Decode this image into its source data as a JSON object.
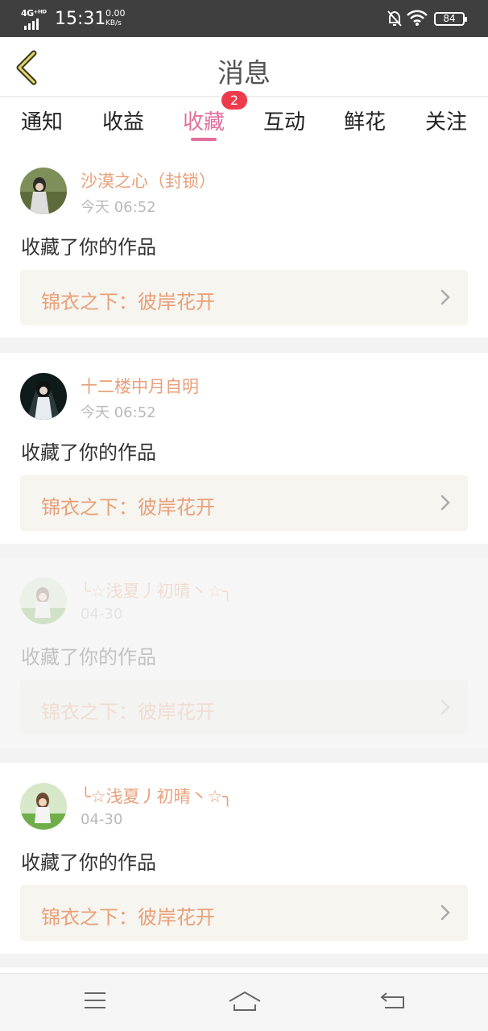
{
  "status_bar": {
    "network": "4G⁺ᴴᴰ",
    "time": "15:31",
    "speed_value": "0.00",
    "speed_unit": "KB/s",
    "battery": "84"
  },
  "header": {
    "title": "消息",
    "back_icon": "chevron-left-icon"
  },
  "tabs": [
    {
      "label": "通知"
    },
    {
      "label": "收益"
    },
    {
      "label": "收藏",
      "active": true,
      "badge": "2"
    },
    {
      "label": "互动"
    },
    {
      "label": "鲜花"
    },
    {
      "label": "关注"
    }
  ],
  "messages": [
    {
      "user": "沙漠之心（封锁）",
      "time": "今天 06:52",
      "action": "收藏了你的作品",
      "work": "锦衣之下：彼岸花开"
    },
    {
      "user": "十二楼中月自明",
      "time": "今天 06:52",
      "action": "收藏了你的作品",
      "work": "锦衣之下：彼岸花开"
    },
    {
      "user": "╰☆浅夏丿初晴丶☆╮",
      "time": "04-30",
      "action": "收藏了你的作品",
      "work": "锦衣之下：彼岸花开"
    },
    {
      "user": "╰☆浅夏丿初晴丶☆╮",
      "time": "04-30",
      "action": "收藏了你的作品",
      "work": "锦衣之下：彼岸花开"
    }
  ],
  "nav_bar": {
    "menu_icon": "menu-icon",
    "home_icon": "home-icon",
    "back_icon": "back-icon"
  },
  "colors": {
    "accent": "#e0709c",
    "username": "#e8a07a",
    "badge": "#ee3b4c"
  }
}
